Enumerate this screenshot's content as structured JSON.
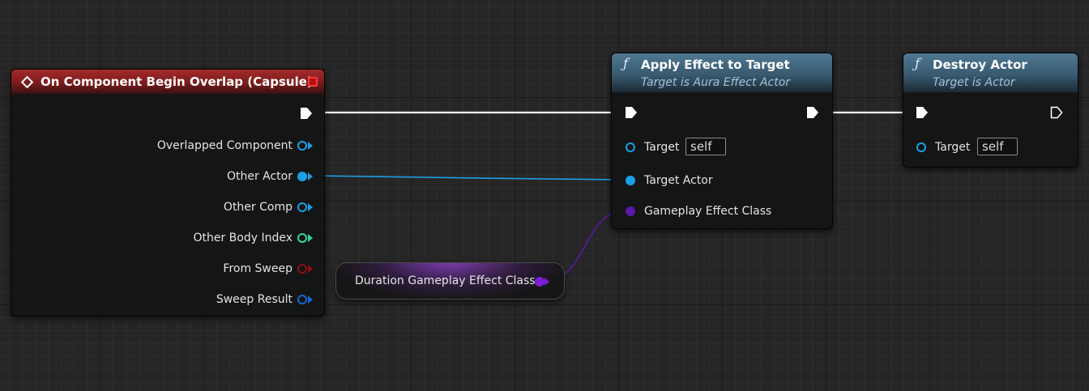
{
  "event_node": {
    "title": "On Component Begin Overlap (Capsule)",
    "pins": [
      {
        "label": "Overlapped Component",
        "icon": "object-pin-icon",
        "color": "#1a9fe8"
      },
      {
        "label": "Other Actor",
        "icon": "actor-pin-icon",
        "color": "#1a9fe8"
      },
      {
        "label": "Other Comp",
        "icon": "object-pin-icon",
        "color": "#1a9fe8"
      },
      {
        "label": "Other Body Index",
        "icon": "integer-pin-icon",
        "color": "#2fd7a6"
      },
      {
        "label": "From Sweep",
        "icon": "boolean-pin-icon",
        "color": "#8c0f0f"
      },
      {
        "label": "Sweep Result",
        "icon": "struct-pin-icon",
        "color": "#1667d6"
      }
    ]
  },
  "apply_node": {
    "title": "Apply Effect to Target",
    "subtitle": "Target is Aura Effect Actor",
    "target_label": "Target",
    "target_value": "self",
    "target_actor_label": "Target Actor",
    "gameplay_effect_label": "Gameplay Effect Class"
  },
  "destroy_node": {
    "title": "Destroy Actor",
    "subtitle": "Target is Actor",
    "target_label": "Target",
    "target_value": "self"
  },
  "variable_node": {
    "label": "Duration Gameplay Effect Class",
    "color": "#7a1fd6"
  },
  "colors": {
    "exec_wire": "#ffffff",
    "object_wire": "#1a9fe8",
    "class_wire": "#5a18a8"
  }
}
